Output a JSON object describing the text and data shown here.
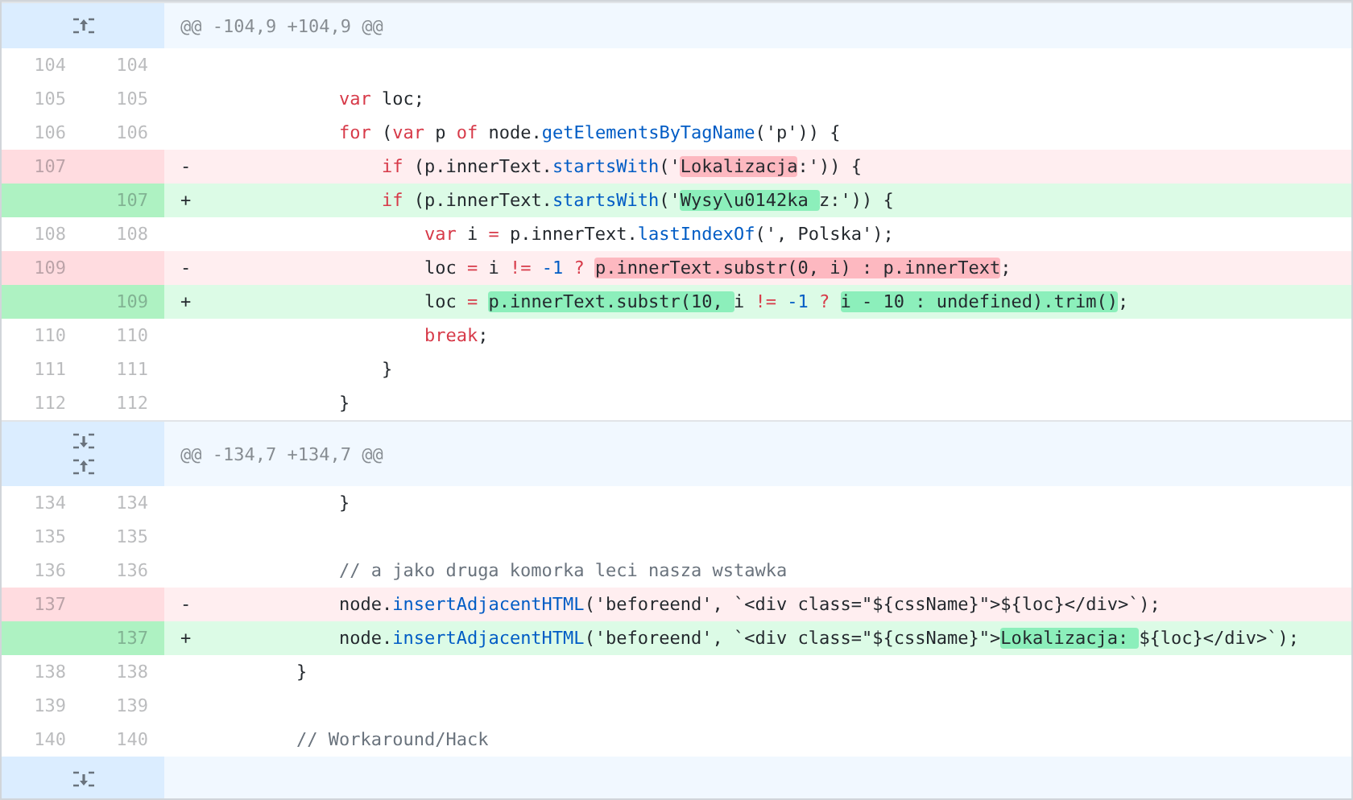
{
  "diff": {
    "hunks": [
      {
        "header": "@@ -104,9 +104,9 @@",
        "expanders": [
          {
            "kind": "up"
          }
        ],
        "lines": [
          {
            "kind": "context",
            "old": "104",
            "new": "104"
          },
          {
            "kind": "context",
            "old": "105",
            "new": "105",
            "code": [
              {
                "text": "            var",
                "kind": "keyword"
              },
              {
                "text": " loc;",
                "kind": "plain"
              }
            ]
          },
          {
            "kind": "context",
            "old": "106",
            "new": "106",
            "code": [
              {
                "text": "            for",
                "kind": "keyword"
              },
              {
                "text": " (",
                "kind": "plain"
              },
              {
                "text": "var",
                "kind": "keyword"
              },
              {
                "text": " p ",
                "kind": "plain"
              },
              {
                "text": "of",
                "kind": "keyword"
              },
              {
                "text": " node.",
                "kind": "plain"
              },
              {
                "text": "getElementsByTagName",
                "kind": "method"
              },
              {
                "text": "('p')) {",
                "kind": "plain"
              }
            ]
          },
          {
            "kind": "deleted",
            "old": "107",
            "sign": "-",
            "code": [
              {
                "text": "                if",
                "kind": "keyword"
              },
              {
                "text": " (p.innerText.",
                "kind": "plain"
              },
              {
                "text": "startsWith",
                "kind": "method"
              },
              {
                "text": "('",
                "kind": "plain"
              },
              {
                "text": "Lokalizacja",
                "kind": "highlight"
              },
              {
                "text": ":')) {",
                "kind": "plain"
              }
            ]
          },
          {
            "kind": "added",
            "new": "107",
            "sign": "+",
            "code": [
              {
                "text": "                if",
                "kind": "keyword"
              },
              {
                "text": " (p.innerText.",
                "kind": "plain"
              },
              {
                "text": "startsWith",
                "kind": "method"
              },
              {
                "text": "('",
                "kind": "plain"
              },
              {
                "text": "Wysy\\u0142ka ",
                "kind": "highlight"
              },
              {
                "text": "z:')) {",
                "kind": "plain"
              }
            ]
          },
          {
            "kind": "context",
            "old": "108",
            "new": "108",
            "code": [
              {
                "text": "                    var",
                "kind": "keyword"
              },
              {
                "text": " i ",
                "kind": "plain"
              },
              {
                "text": "=",
                "kind": "operator"
              },
              {
                "text": " p.innerText.",
                "kind": "plain"
              },
              {
                "text": "lastIndexOf",
                "kind": "method"
              },
              {
                "text": "(', Polska');",
                "kind": "plain"
              }
            ]
          },
          {
            "kind": "deleted",
            "old": "109",
            "sign": "-",
            "code": [
              {
                "text": "                    loc ",
                "kind": "plain"
              },
              {
                "text": "=",
                "kind": "operator"
              },
              {
                "text": " i ",
                "kind": "plain"
              },
              {
                "text": "!=",
                "kind": "operator"
              },
              {
                "text": " -1",
                "kind": "number"
              },
              {
                "text": " ? ",
                "kind": "operator"
              },
              {
                "text": "p.innerText.substr(0, i) : p.innerText",
                "kind": "highlight"
              },
              {
                "text": ";",
                "kind": "plain"
              }
            ]
          },
          {
            "kind": "added",
            "new": "109",
            "sign": "+",
            "code": [
              {
                "text": "                    loc ",
                "kind": "plain"
              },
              {
                "text": "= ",
                "kind": "operator"
              },
              {
                "text": "p.innerText.substr(10, ",
                "kind": "highlight"
              },
              {
                "text": "i ",
                "kind": "plain"
              },
              {
                "text": "!=",
                "kind": "operator"
              },
              {
                "text": " -1",
                "kind": "number"
              },
              {
                "text": " ? ",
                "kind": "operator"
              },
              {
                "text": "i - 10 : undefined).trim()",
                "kind": "highlight"
              },
              {
                "text": ";",
                "kind": "plain"
              }
            ]
          },
          {
            "kind": "context",
            "old": "110",
            "new": "110",
            "code": [
              {
                "text": "                    break",
                "kind": "keyword"
              },
              {
                "text": ";",
                "kind": "plain"
              }
            ]
          },
          {
            "kind": "context",
            "old": "111",
            "new": "111",
            "code": [
              {
                "text": "                }",
                "kind": "plain"
              }
            ]
          },
          {
            "kind": "context",
            "old": "112",
            "new": "112",
            "code": [
              {
                "text": "            }",
                "kind": "plain"
              }
            ]
          }
        ]
      },
      {
        "header": "@@ -134,7 +134,7 @@",
        "expanders": [
          {
            "kind": "down"
          },
          {
            "kind": "up"
          }
        ],
        "lines": [
          {
            "kind": "context",
            "old": "134",
            "new": "134",
            "code": [
              {
                "text": "            }",
                "kind": "plain"
              }
            ]
          },
          {
            "kind": "context",
            "old": "135",
            "new": "135"
          },
          {
            "kind": "context",
            "old": "136",
            "new": "136",
            "code": [
              {
                "text": "            // a jako druga komorka leci nasza wstawka",
                "kind": "comment"
              }
            ]
          },
          {
            "kind": "deleted",
            "old": "137",
            "sign": "-",
            "code": [
              {
                "text": "            node.",
                "kind": "plain"
              },
              {
                "text": "insertAdjacentHTML",
                "kind": "method"
              },
              {
                "text": "('beforeend', `<div class=\"${cssName}\">${loc}</div>`);",
                "kind": "plain"
              }
            ]
          },
          {
            "kind": "added",
            "new": "137",
            "sign": "+",
            "code": [
              {
                "text": "            node.",
                "kind": "plain"
              },
              {
                "text": "insertAdjacentHTML",
                "kind": "method"
              },
              {
                "text": "('beforeend', `<div class=\"${cssName}\">",
                "kind": "plain"
              },
              {
                "text": "Lokalizacja: ",
                "kind": "highlight"
              },
              {
                "text": "${loc}</div>`);",
                "kind": "plain"
              }
            ]
          },
          {
            "kind": "context",
            "old": "138",
            "new": "138",
            "code": [
              {
                "text": "        }",
                "kind": "plain"
              }
            ]
          },
          {
            "kind": "context",
            "old": "139",
            "new": "139"
          },
          {
            "kind": "context",
            "old": "140",
            "new": "140",
            "code": [
              {
                "text": "        // Workaround/Hack",
                "kind": "comment"
              }
            ]
          }
        ]
      }
    ],
    "footer": {
      "expanders": [
        {
          "kind": "down"
        }
      ]
    }
  }
}
